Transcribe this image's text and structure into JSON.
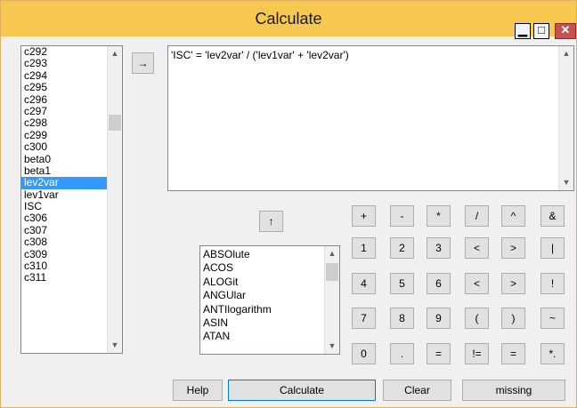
{
  "window": {
    "title": "Calculate",
    "min_glyph": "▁",
    "max_glyph": "□",
    "close_glyph": "✕"
  },
  "variables": {
    "items": [
      "c292",
      "c293",
      "c294",
      "c295",
      "c296",
      "c297",
      "c298",
      "c299",
      "c300",
      "beta0",
      "beta1",
      "lev2var",
      "lev1var",
      "ISC",
      "c306",
      "c307",
      "c308",
      "c309",
      "c310",
      "c311"
    ],
    "selected": "lev2var"
  },
  "insert_button_glyph": "→",
  "up_button_glyph": "↑",
  "expression": "'ISC' = 'lev2var' / ('lev1var' + 'lev2var')",
  "functions": {
    "items": [
      "ABSOlute",
      "ACOS",
      "ALOGit",
      "ANGUlar",
      "ANTIlogarithm",
      "ASIN",
      "ATAN"
    ]
  },
  "keypad": [
    [
      "+",
      "-",
      "*",
      "/",
      "^",
      "&"
    ],
    [
      "1",
      "2",
      "3",
      "<",
      ">",
      "|"
    ],
    [
      "4",
      "5",
      "6",
      "<",
      ">",
      "!"
    ],
    [
      "7",
      "8",
      "9",
      "(",
      ")",
      "~"
    ],
    [
      "0",
      ".",
      "=",
      "!=",
      "=",
      "*."
    ]
  ],
  "buttons": {
    "help": "Help",
    "calculate": "Calculate",
    "clear": "Clear",
    "missing": "missing"
  },
  "colors": {
    "titlebar": "#f6c84f",
    "selection": "#3399ff",
    "close": "#c75050"
  }
}
